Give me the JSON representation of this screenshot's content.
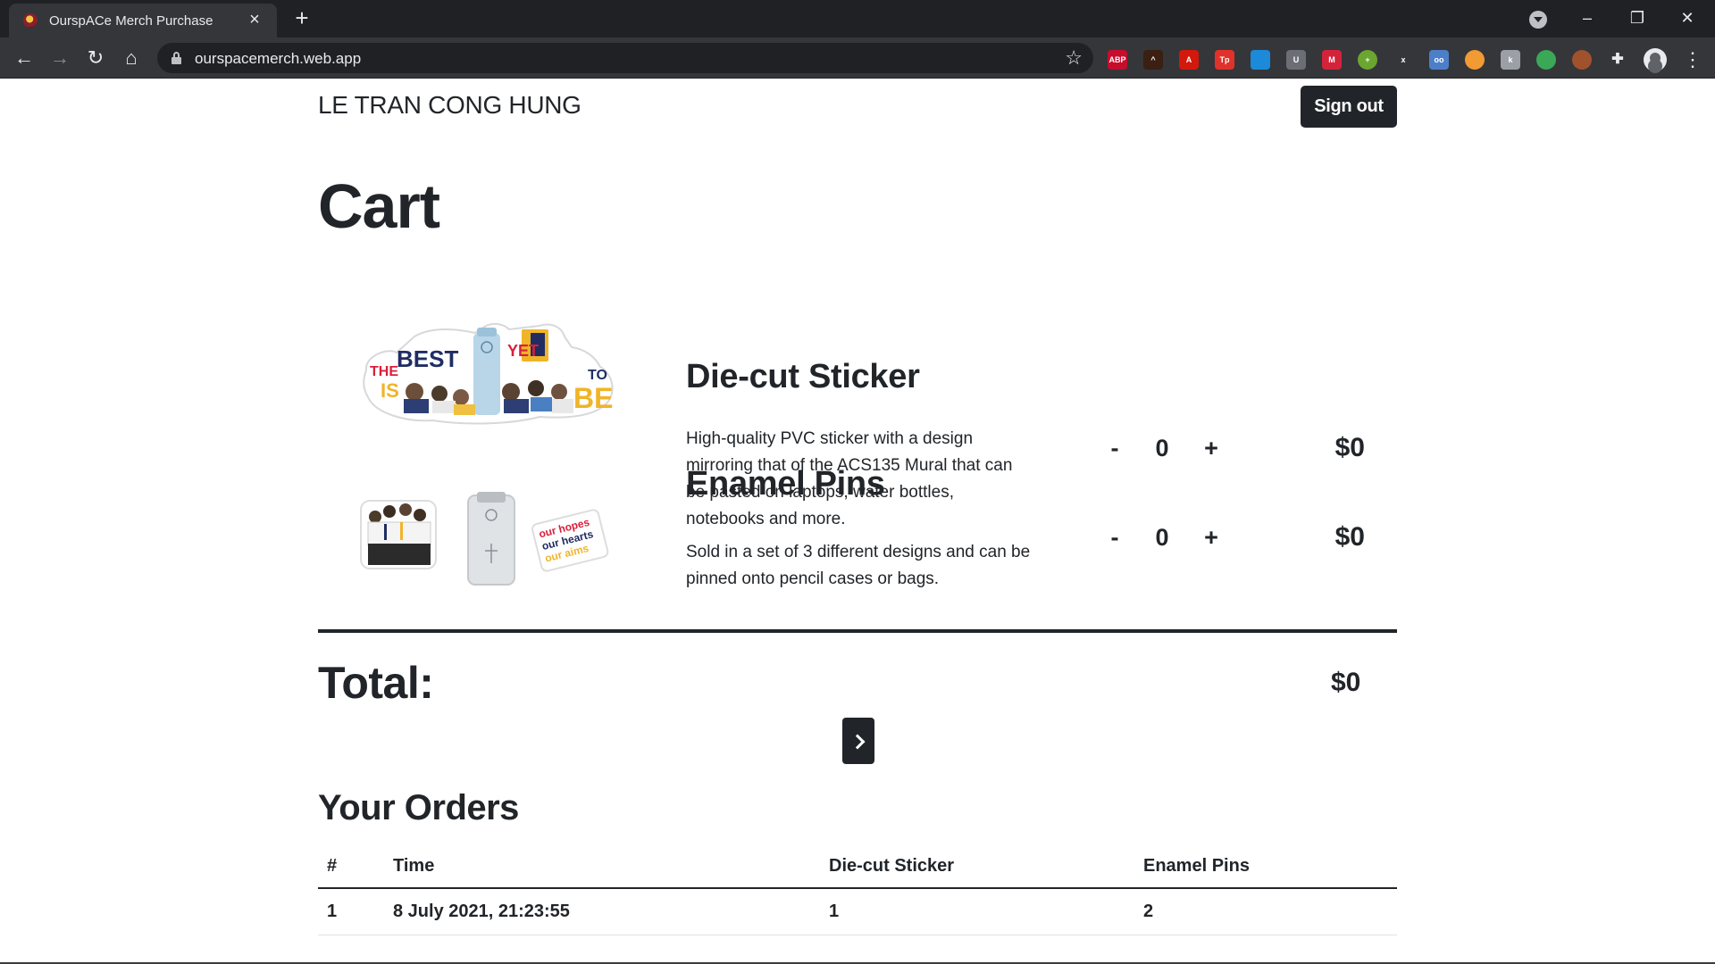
{
  "browser": {
    "tab_title": "OurspACe Merch Purchase",
    "url": "ourspacemerch.web.app",
    "extensions": [
      {
        "name": "adblock-plus-icon",
        "label": "ABP",
        "color": "#c70d2c"
      },
      {
        "name": "extension-icon-2",
        "label": "^",
        "color": "#3a1f12"
      },
      {
        "name": "pdf-icon",
        "label": "A",
        "color": "#d3180c"
      },
      {
        "name": "extension-icon-tp",
        "label": "Tp",
        "color": "#e0322b"
      },
      {
        "name": "extension-icon-window",
        "label": "",
        "color": "#1c8ad8"
      },
      {
        "name": "shield-extension-icon",
        "label": "U",
        "color": "#6b6f75"
      },
      {
        "name": "extension-icon-m",
        "label": "M",
        "color": "#d3233a"
      },
      {
        "name": "add-extension-icon",
        "label": "+",
        "color": "#6aa630"
      },
      {
        "name": "extension-icon-x",
        "label": "x",
        "color": "#35363a"
      },
      {
        "name": "extension-icon-glasses",
        "label": "oo",
        "color": "#4d7fc9"
      },
      {
        "name": "extension-icon-drop",
        "label": "",
        "color": "#f29a33"
      },
      {
        "name": "extension-icon-k",
        "label": "k",
        "color": "#9aa0a6"
      },
      {
        "name": "extension-icon-leaf",
        "label": "",
        "color": "#3aa857"
      },
      {
        "name": "extension-icon-avatar",
        "label": "",
        "color": "#a0522d"
      },
      {
        "name": "puzzle-icon",
        "label": "",
        "color": "#35363a"
      }
    ]
  },
  "header": {
    "user_name": "LE TRAN CONG HUNG",
    "signout_label": "Sign out"
  },
  "cart": {
    "title": "Cart",
    "products": [
      {
        "name": "Die-cut Sticker",
        "description": "High-quality PVC sticker with a design mirroring that of the ACS135 Mural that can be pasted on laptops, water bottles, notebooks and more.",
        "minus": "-",
        "quantity": "0",
        "plus": "+",
        "price": "$0",
        "image_text": {
          "the": "THE",
          "best": "BEST",
          "yet": "YET",
          "is": "IS",
          "to": "TO",
          "be": "BE"
        }
      },
      {
        "name": "Enamel Pins",
        "description": "Sold in a set of 3 different designs and can be pinned onto pencil cases or bags.",
        "minus": "-",
        "quantity": "0",
        "plus": "+",
        "price": "$0",
        "image_text": {
          "line1": "our hopes",
          "line2": "our hearts",
          "line3": "our aims"
        }
      }
    ],
    "total_label": "Total:",
    "total_value": "$0"
  },
  "orders": {
    "title": "Your Orders",
    "columns": [
      "#",
      "Time",
      "Die-cut Sticker",
      "Enamel Pins"
    ],
    "rows": [
      [
        "1",
        "8 July 2021, 21:23:55",
        "1",
        "2"
      ]
    ]
  }
}
